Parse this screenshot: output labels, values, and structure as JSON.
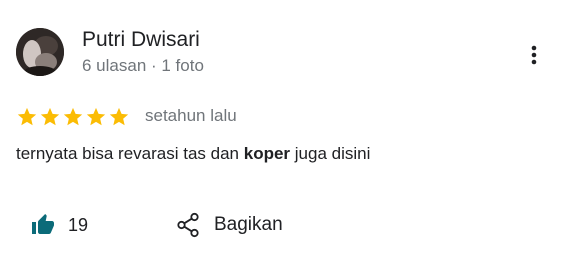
{
  "review": {
    "reviewer": {
      "name": "Putri Dwisari",
      "meta": "6 ulasan · 1 foto",
      "avatar_icon": "profile-photo"
    },
    "rating": {
      "stars": 5,
      "max": 5,
      "color": "#fbbc04"
    },
    "date": "setahun lalu",
    "text": {
      "before": "ternyata bisa revarasi tas dan ",
      "highlight": "koper",
      "after": " juga disini"
    },
    "actions": {
      "like_icon": "thumbs-up-icon",
      "like_color": "#0b6b79",
      "like_count": "19",
      "share_icon": "share-icon",
      "share_label": "Bagikan",
      "more_icon": "more-vertical-icon"
    }
  }
}
